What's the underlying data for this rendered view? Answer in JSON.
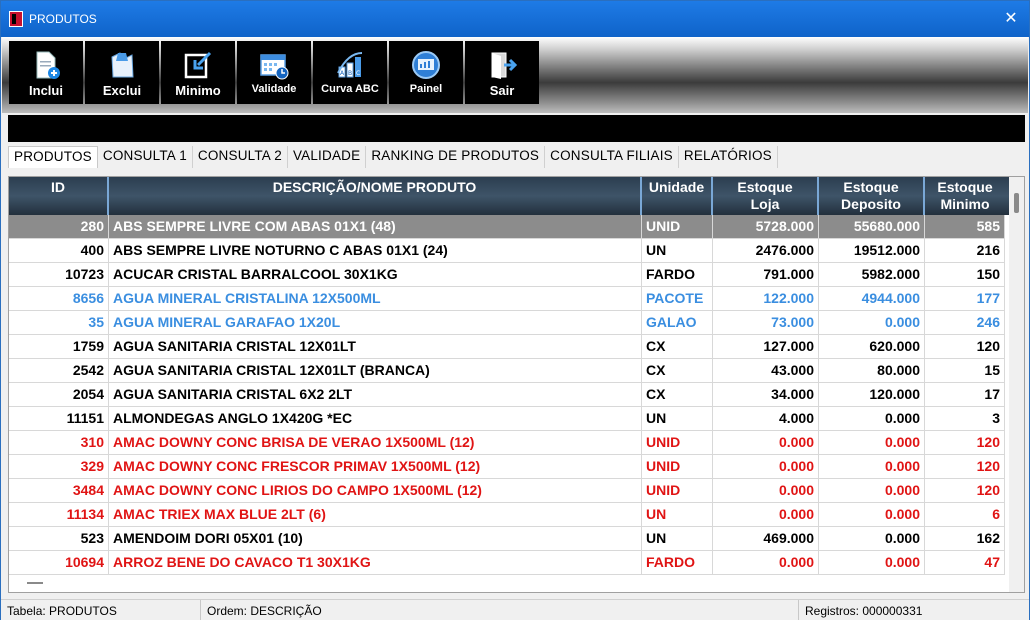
{
  "window": {
    "title": "PRODUTOS",
    "close_glyph": "✕"
  },
  "toolbar": [
    {
      "label": "Inclui",
      "icon": "add-document-icon"
    },
    {
      "label": "Exclui",
      "icon": "delete-document-icon"
    },
    {
      "label": "Minimo",
      "icon": "minimum-arrow-icon"
    },
    {
      "label": "Validade",
      "icon": "calendar-clock-icon"
    },
    {
      "label": "Curva ABC",
      "icon": "abc-curve-icon"
    },
    {
      "label": "Painel",
      "icon": "panel-icon"
    },
    {
      "label": "Sair",
      "icon": "exit-door-icon"
    }
  ],
  "tabs": [
    "PRODUTOS",
    "CONSULTA 1",
    "CONSULTA 2",
    "VALIDADE",
    "RANKING DE PRODUTOS",
    "CONSULTA FILIAIS",
    "RELATÓRIOS"
  ],
  "grid": {
    "headers": {
      "id": "ID",
      "desc": "DESCRIÇÃO/NOME PRODUTO",
      "unit": "Unidade",
      "loja": [
        "Estoque",
        "Loja"
      ],
      "dep": [
        "Estoque",
        "Deposito"
      ],
      "min": [
        "Estoque",
        "Minimo"
      ]
    },
    "rows": [
      {
        "id": "280",
        "desc": "ABS SEMPRE LIVRE COM ABAS 01X1 (48)",
        "unit": "UNID",
        "loja": "5728.000",
        "dep": "55680.000",
        "min": "585",
        "color": "selected"
      },
      {
        "id": "400",
        "desc": "ABS SEMPRE LIVRE NOTURNO C ABAS 01X1 (24)",
        "unit": "UN",
        "loja": "2476.000",
        "dep": "19512.000",
        "min": "216",
        "color": "black"
      },
      {
        "id": "10723",
        "desc": "ACUCAR CRISTAL BARRALCOOL  30X1KG",
        "unit": "FARDO",
        "loja": "791.000",
        "dep": "5982.000",
        "min": "150",
        "color": "black"
      },
      {
        "id": "8656",
        "desc": "AGUA MINERAL CRISTALINA 12X500ML",
        "unit": "PACOTE",
        "loja": "122.000",
        "dep": "4944.000",
        "min": "177",
        "color": "blue"
      },
      {
        "id": "35",
        "desc": "AGUA MINERAL GARAFAO 1X20L",
        "unit": "GALAO",
        "loja": "73.000",
        "dep": "0.000",
        "min": "246",
        "color": "blue"
      },
      {
        "id": "1759",
        "desc": "AGUA SANITARIA CRISTAL 12X01LT",
        "unit": "CX",
        "loja": "127.000",
        "dep": "620.000",
        "min": "120",
        "color": "black"
      },
      {
        "id": "2542",
        "desc": "AGUA SANITARIA CRISTAL 12X01LT (BRANCA)",
        "unit": "CX",
        "loja": "43.000",
        "dep": "80.000",
        "min": "15",
        "color": "black"
      },
      {
        "id": "2054",
        "desc": "AGUA SANITARIA CRISTAL 6X2 2LT",
        "unit": "CX",
        "loja": "34.000",
        "dep": "120.000",
        "min": "17",
        "color": "black"
      },
      {
        "id": "11151",
        "desc": "ALMONDEGAS ANGLO 1X420G *EC",
        "unit": "UN",
        "loja": "4.000",
        "dep": "0.000",
        "min": "3",
        "color": "black"
      },
      {
        "id": "310",
        "desc": "AMAC DOWNY CONC BRISA DE VERAO 1X500ML (12)",
        "unit": "UNID",
        "loja": "0.000",
        "dep": "0.000",
        "min": "120",
        "color": "red"
      },
      {
        "id": "329",
        "desc": "AMAC DOWNY CONC FRESCOR PRIMAV 1X500ML (12)",
        "unit": "UNID",
        "loja": "0.000",
        "dep": "0.000",
        "min": "120",
        "color": "red"
      },
      {
        "id": "3484",
        "desc": "AMAC DOWNY CONC LIRIOS DO CAMPO 1X500ML (12)",
        "unit": "UNID",
        "loja": "0.000",
        "dep": "0.000",
        "min": "120",
        "color": "red"
      },
      {
        "id": "11134",
        "desc": "AMAC TRIEX MAX BLUE 2LT (6)",
        "unit": "UN",
        "loja": "0.000",
        "dep": "0.000",
        "min": "6",
        "color": "red"
      },
      {
        "id": "523",
        "desc": "AMENDOIM DORI 05X01 (10)",
        "unit": "UN",
        "loja": "469.000",
        "dep": "0.000",
        "min": "162",
        "color": "black"
      },
      {
        "id": "10694",
        "desc": "ARROZ BENE DO CAVACO T1 30X1KG",
        "unit": "FARDO",
        "loja": "0.000",
        "dep": "0.000",
        "min": "47",
        "color": "red"
      }
    ]
  },
  "status": {
    "tabela": "Tabela: PRODUTOS",
    "ordem": "Ordem: DESCRIÇÃO",
    "registros": "Registros: 000000331"
  },
  "colors": {
    "selected_row": "#8c8c8c",
    "blue_text": "#3a8ee0",
    "red_text": "#e01414",
    "title_bar": "#1570d8"
  }
}
